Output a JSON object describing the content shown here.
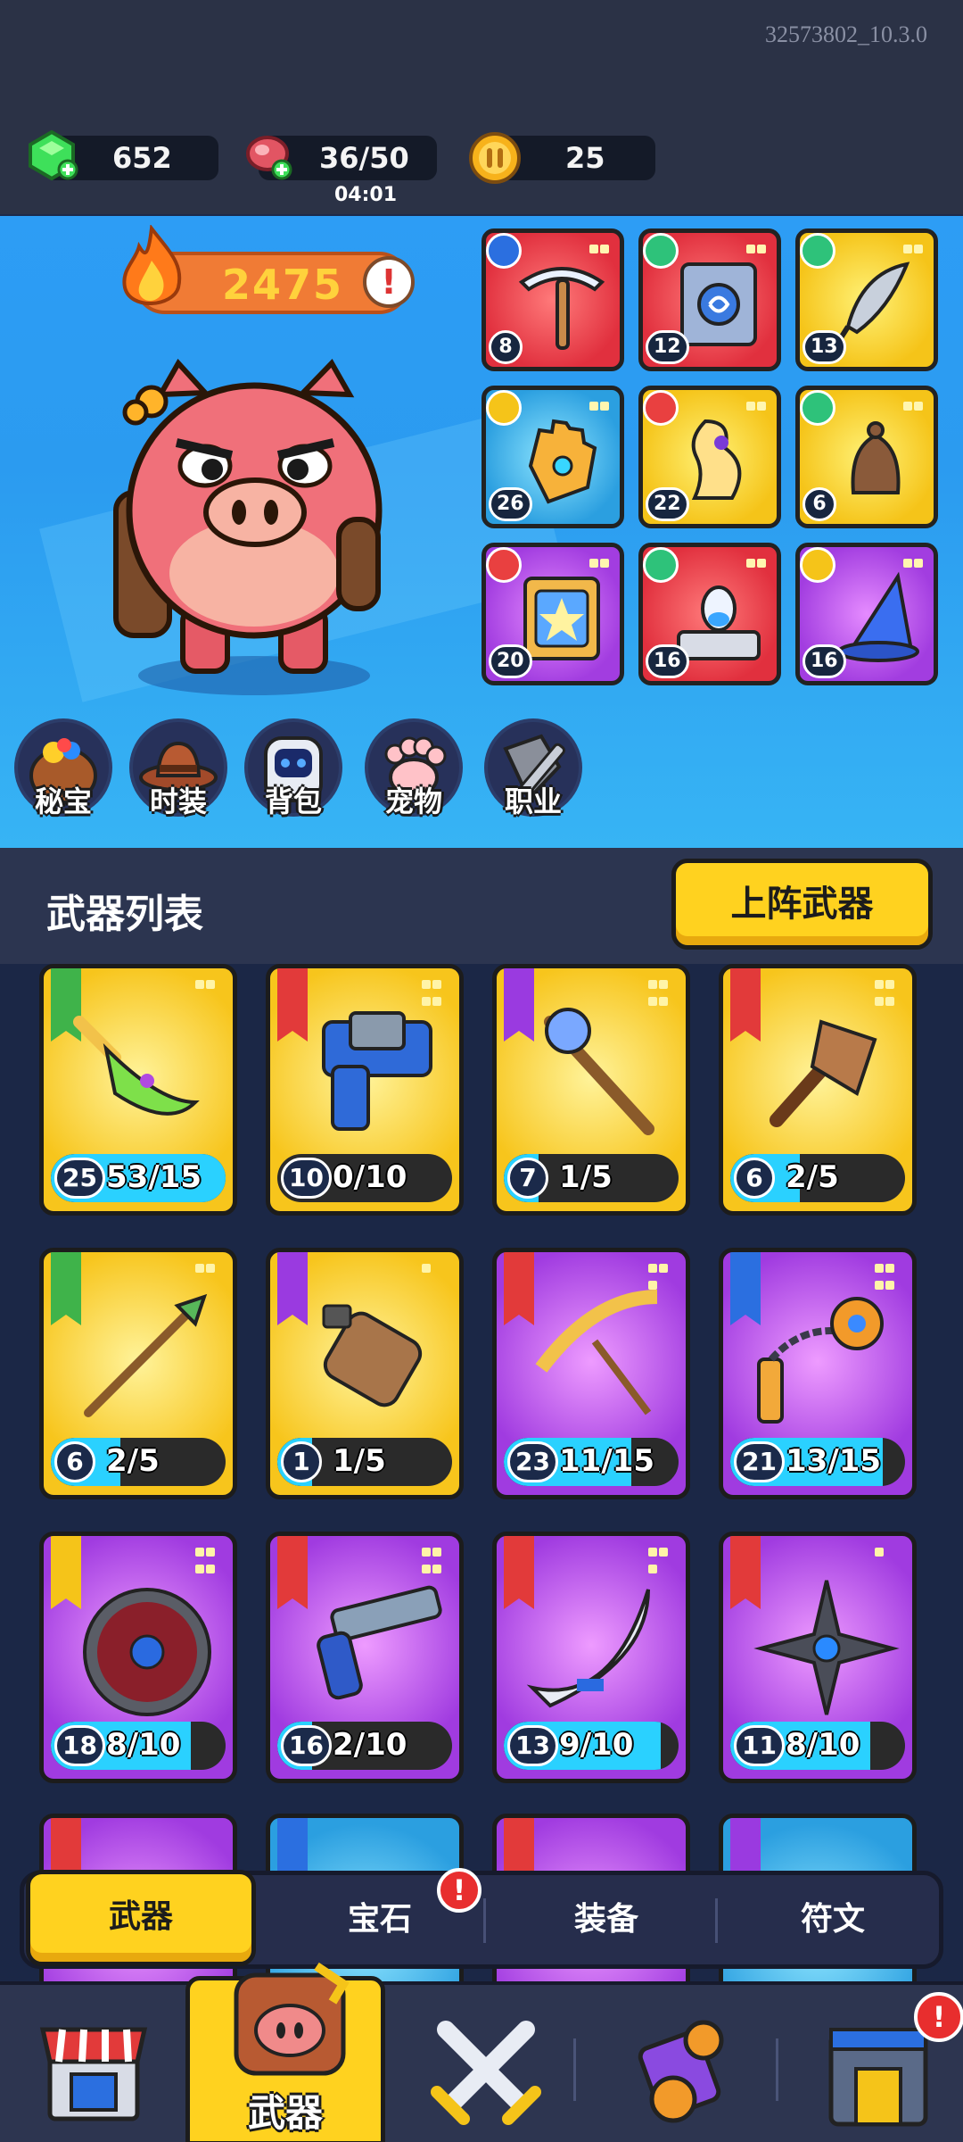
{
  "build_id": "32573802_10.3.0",
  "resources": {
    "gems": "652",
    "stamina": "36/50",
    "stamina_timer": "04:01",
    "coins": "25"
  },
  "hero": {
    "power": "2475",
    "power_alert": "!"
  },
  "equipped": [
    {
      "level": "8",
      "rarity": "red",
      "item": "pickaxe-icon"
    },
    {
      "level": "12",
      "rarity": "red",
      "item": "spellbook-icon"
    },
    {
      "level": "13",
      "rarity": "gold",
      "item": "feather-icon"
    },
    {
      "level": "26",
      "rarity": "blue",
      "item": "glove-icon"
    },
    {
      "level": "22",
      "rarity": "gold",
      "item": "dragon-statue-icon"
    },
    {
      "level": "6",
      "rarity": "gold",
      "item": "bell-icon"
    },
    {
      "level": "20",
      "rarity": "purple",
      "item": "tome-icon"
    },
    {
      "level": "16",
      "rarity": "red",
      "item": "potion-altar-icon"
    },
    {
      "level": "16",
      "rarity": "purple",
      "item": "wizard-hat-icon"
    }
  ],
  "categories": [
    "秘宝",
    "时装",
    "背包",
    "宠物",
    "职业"
  ],
  "list": {
    "title": "武器列表",
    "deploy_button": "上阵武器"
  },
  "weapons": [
    {
      "level": "25",
      "count": "53/15",
      "progress": 1.0,
      "rarity": "gold",
      "item": "dragon-sword-icon"
    },
    {
      "level": "10",
      "count": "0/10",
      "progress": 0.0,
      "rarity": "gold",
      "item": "blaster-icon"
    },
    {
      "level": "7",
      "count": "1/5",
      "progress": 0.2,
      "rarity": "gold",
      "item": "magic-staff-icon"
    },
    {
      "level": "6",
      "count": "2/5",
      "progress": 0.4,
      "rarity": "gold",
      "item": "axe-icon"
    },
    {
      "level": "6",
      "count": "2/5",
      "progress": 0.4,
      "rarity": "gold",
      "item": "spear-icon"
    },
    {
      "level": "1",
      "count": "1/5",
      "progress": 0.2,
      "rarity": "gold",
      "item": "battery-icon"
    },
    {
      "level": "23",
      "count": "11/15",
      "progress": 0.73,
      "rarity": "purple",
      "item": "bone-scythe-icon"
    },
    {
      "level": "21",
      "count": "13/15",
      "progress": 0.87,
      "rarity": "purple",
      "item": "flail-icon"
    },
    {
      "level": "18",
      "count": "8/10",
      "progress": 0.8,
      "rarity": "purple",
      "item": "shield-icon"
    },
    {
      "level": "16",
      "count": "2/10",
      "progress": 0.2,
      "rarity": "purple",
      "item": "revolver-icon"
    },
    {
      "level": "13",
      "count": "9/10",
      "progress": 0.9,
      "rarity": "purple",
      "item": "boomerang-icon"
    },
    {
      "level": "11",
      "count": "8/10",
      "progress": 0.8,
      "rarity": "purple",
      "item": "shuriken-icon"
    }
  ],
  "sub_tabs": {
    "weapons": "武器",
    "gems": "宝石",
    "gems_alert": "!",
    "gear": "装备",
    "runes": "符文"
  },
  "bottom_nav": {
    "weapons_label": "武器",
    "forge_alert": "!"
  },
  "colors": {
    "accent_yellow": "#ffd21f",
    "progress_cyan": "#2ad1ff",
    "alert_red": "#e82e2e",
    "hero_blue": "#2d9df5"
  }
}
